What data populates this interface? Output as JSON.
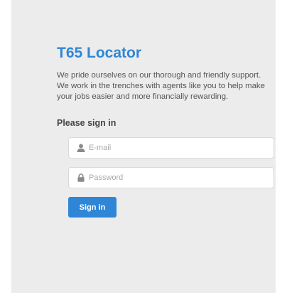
{
  "app": {
    "title": "T65 Locator",
    "intro": "We pride ourselves on our thorough and friendly support. We work in the trenches with agents like you to help make your jobs easier and more financially rewarding."
  },
  "signin": {
    "heading": "Please sign in",
    "email": {
      "icon": "user-icon",
      "placeholder": "E-mail",
      "value": ""
    },
    "password": {
      "icon": "lock-icon",
      "placeholder": "Password",
      "value": ""
    },
    "submit_label": "Sign in"
  },
  "colors": {
    "accent": "#2f86d6",
    "panel": "#ececec",
    "icon": "#8a8a8a"
  }
}
